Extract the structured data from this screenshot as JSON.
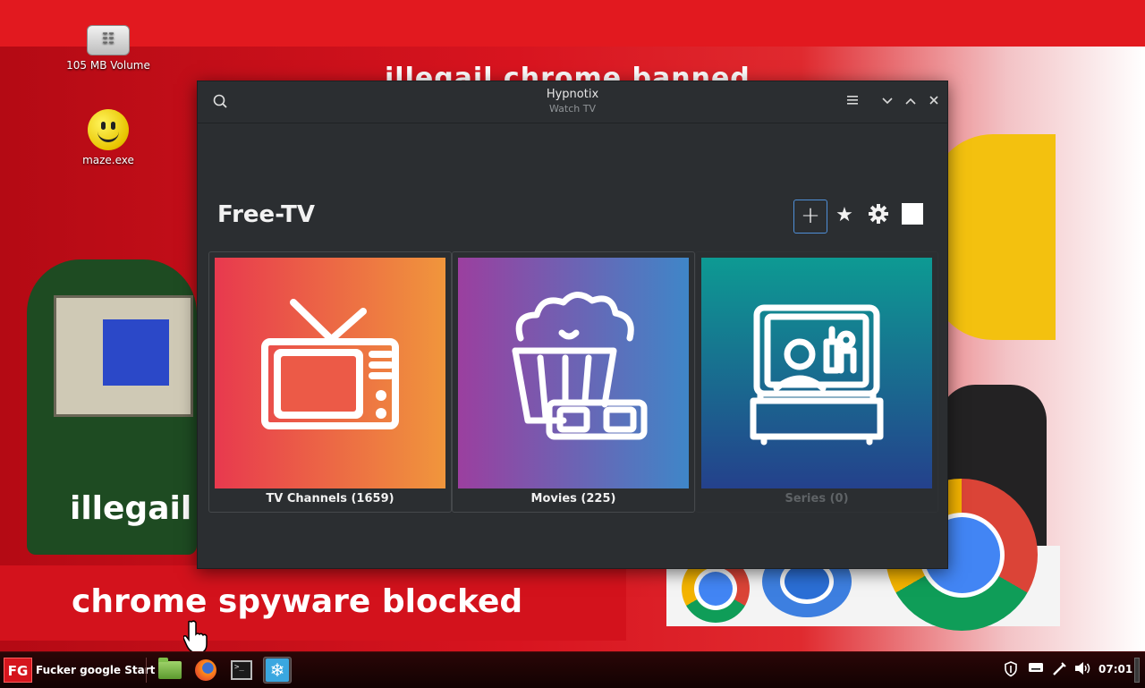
{
  "desktop": {
    "icons": [
      {
        "label": "105 MB Volume",
        "icon": "usb-drive-icon"
      },
      {
        "label": "maze.exe",
        "icon": "smiley-icon"
      }
    ],
    "wallpaper": {
      "headline": "illegail chrome banned",
      "illegal_text": "illegail c",
      "slogan": "chrome spyware blocked"
    }
  },
  "window": {
    "title": "Hypnotix",
    "subtitle": "Watch TV",
    "search_icon": "search-icon",
    "menu_icon": "hamburger-menu-icon",
    "minimize_icon": "chevron-down-icon",
    "maximize_icon": "chevron-up-icon",
    "close_icon": "close-icon"
  },
  "main": {
    "provider": "Free-TV",
    "toolbar": {
      "add_icon": "plus-icon",
      "favorites_icon": "star-icon",
      "settings_icon": "gear-icon",
      "fullscreen_icon": "square-icon"
    },
    "cards": [
      {
        "label": "TV Channels (1659)",
        "icon": "tv-icon",
        "enabled": true
      },
      {
        "label": "Movies (225)",
        "icon": "popcorn-icon",
        "enabled": true
      },
      {
        "label": "Series (0)",
        "icon": "series-icon",
        "enabled": false
      }
    ]
  },
  "taskbar": {
    "start_logo": "FG",
    "start_label": "Fucker google Start",
    "launchers": [
      {
        "name": "files",
        "icon": "folder-icon"
      },
      {
        "name": "firefox",
        "icon": "firefox-icon"
      },
      {
        "name": "terminal",
        "icon": "terminal-icon"
      },
      {
        "name": "hypnotix",
        "icon": "hypnotix-icon"
      }
    ],
    "tray_icons": [
      "shield-icon",
      "keyboard-icon",
      "pen-icon",
      "volume-icon"
    ],
    "clock": "07:01"
  },
  "colors": {
    "window_bg": "#2b2e31",
    "accent": "#4f8fd8",
    "taskbar_bg": "#1a0404",
    "wallpaper_red": "#d8141f"
  }
}
